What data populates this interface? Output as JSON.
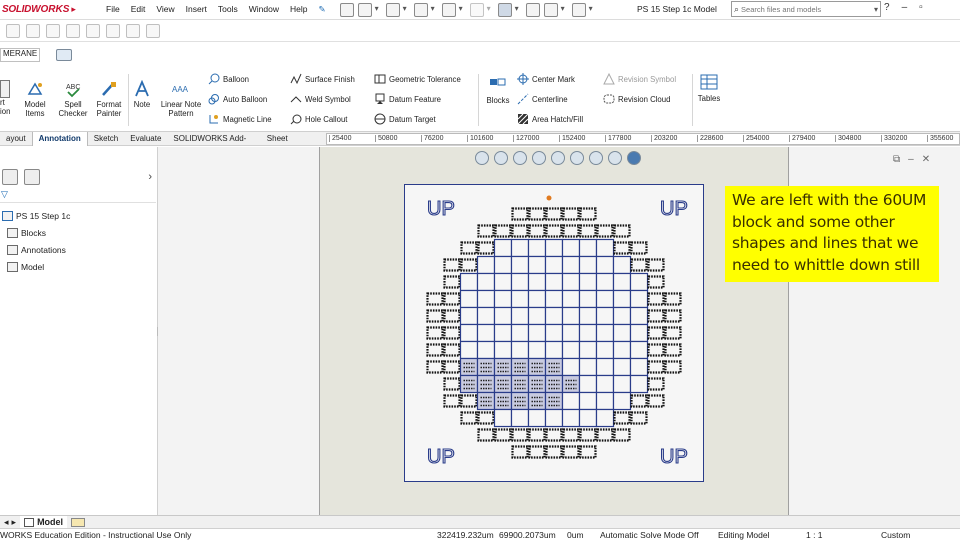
{
  "app": {
    "logo_a": "SOLID",
    "logo_b": "WORKS",
    "document_title": "PS 15 Step 1c Model"
  },
  "menu": [
    "File",
    "Edit",
    "View",
    "Insert",
    "Tools",
    "Window",
    "Help"
  ],
  "search": {
    "placeholder": "Search files and models"
  },
  "ribbon": {
    "left_tab_partial": "MERANE",
    "big_buttons": [
      {
        "label": "rt\nion",
        "icon": "text-icon"
      },
      {
        "label": "Model\nItems",
        "icon": "model-items-icon"
      },
      {
        "label": "Spell\nChecker",
        "icon": "spell-checker-icon"
      },
      {
        "label": "Format\nPainter",
        "icon": "format-painter-icon"
      },
      {
        "label": "Note",
        "icon": "note-icon"
      },
      {
        "label": "Linear Note\nPattern",
        "icon": "linear-note-pattern-icon"
      },
      {
        "label": "Blocks",
        "icon": "blocks-icon"
      },
      {
        "label": "Tables",
        "icon": "tables-icon"
      }
    ],
    "col1": [
      "Balloon",
      "Auto Balloon",
      "Magnetic Line"
    ],
    "col2": [
      "Surface Finish",
      "Weld Symbol",
      "Hole Callout"
    ],
    "col3": [
      "Geometric Tolerance",
      "Datum Feature",
      "Datum Target"
    ],
    "col4": [
      "Center Mark",
      "Centerline",
      "Area Hatch/Fill"
    ],
    "col5": [
      "Revision Symbol",
      "Revision Cloud"
    ]
  },
  "tabs": [
    "ayout",
    "Annotation",
    "Sketch",
    "Evaluate",
    "SOLIDWORKS Add-Ins",
    "Sheet Format"
  ],
  "ruler": [
    "25400",
    "50800",
    "76200",
    "101600",
    "127000",
    "152400",
    "177800",
    "203200",
    "228600",
    "254000",
    "279400",
    "304800",
    "330200",
    "355600",
    "3810"
  ],
  "tree": {
    "root": "PS 15 Step 1c",
    "items": [
      "Blocks",
      "Annotations",
      "Model"
    ]
  },
  "drawing": {
    "up_label": "UP"
  },
  "note": "We are left with the 60UM block and some other shapes and lines that we need to whittle down still",
  "bottom_tabs": {
    "model": "Model"
  },
  "status": {
    "edition": "WORKS Education Edition - Instructional Use Only",
    "x": "322419.232um",
    "y": "69900.2073um",
    "z": "0um",
    "mode": "Automatic Solve Mode Off",
    "editing": "Editing Model",
    "scale": "1 : 1",
    "units": "Custom"
  },
  "colors": {
    "accent": "#2a3c8a",
    "note_bg": "#ffff00",
    "logo": "#c8102e"
  }
}
